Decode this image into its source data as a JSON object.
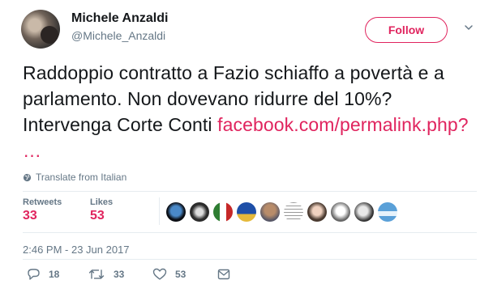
{
  "user": {
    "display_name": "Michele Anzaldi",
    "screen_name": "@Michele_Anzaldi"
  },
  "follow_label": "Follow",
  "tweet": {
    "text": "Raddoppio contratto a Fazio schiaffo a povertà e a parlamento. Non dovevano ridurre del 10%? Intervenga Corte Conti ",
    "link": "facebook.com/permalink.php?  …"
  },
  "translate_label": "Translate from Italian",
  "stats": {
    "retweets_label": "Retweets",
    "retweets_count": "33",
    "likes_label": "Likes",
    "likes_count": "53"
  },
  "timestamp": "2:46 PM - 23 Jun 2017",
  "actions": {
    "reply_count": "18",
    "retweet_count": "33",
    "like_count": "53"
  },
  "colors": {
    "accent": "#e0245e",
    "muted": "#657786",
    "text": "#14171a"
  },
  "icons": [
    "chevron-down-icon",
    "globe-icon",
    "reply-icon",
    "retweet-icon",
    "heart-icon",
    "envelope-icon"
  ]
}
